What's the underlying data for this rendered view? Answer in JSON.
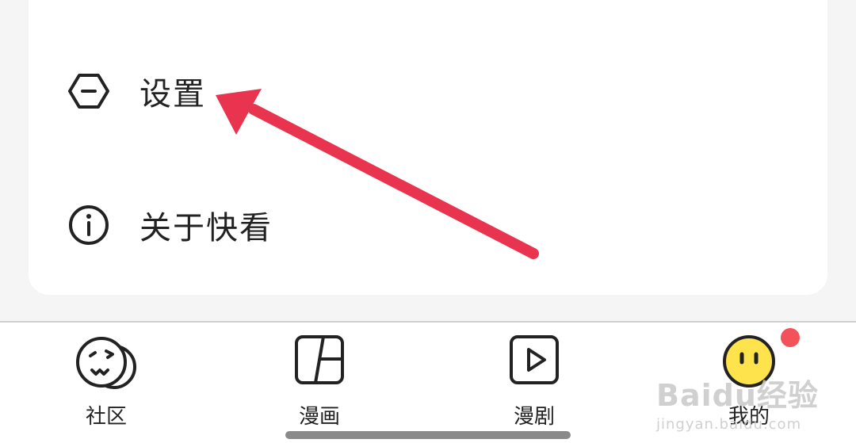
{
  "menu": {
    "items": [
      {
        "label": "设置",
        "icon": "hexagon-minus-icon"
      },
      {
        "label": "关于快看",
        "icon": "info-circle-icon"
      }
    ]
  },
  "tab_bar": {
    "tabs": [
      {
        "label": "社区",
        "icon": "community-face-icon"
      },
      {
        "label": "漫画",
        "icon": "comic-panels-icon"
      },
      {
        "label": "漫剧",
        "icon": "play-square-icon"
      },
      {
        "label": "我的",
        "icon": "yellow-face-icon",
        "selected": true,
        "has_badge": true
      }
    ]
  },
  "annotation": {
    "type": "arrow",
    "color": "#e8344f",
    "points_to": "设置"
  },
  "watermark": {
    "main": "Baidu经验",
    "sub": "jingyan.baidu.com"
  },
  "colors": {
    "badge": "#f4525a",
    "selected_icon": "#ffe34d",
    "arrow": "#e8344f"
  }
}
